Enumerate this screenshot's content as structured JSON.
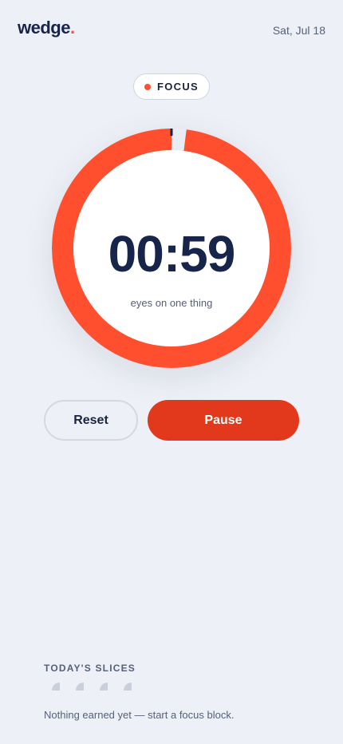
{
  "header": {
    "logo_text": "wedge",
    "logo_dot": ".",
    "date": "Sat, Jul 18"
  },
  "mode": {
    "label": "FOCUS",
    "dot_color": "#ff4f2e"
  },
  "timer": {
    "time": "00:59",
    "caption": "eyes on one thing",
    "progress_elapsed_fraction": 0.02,
    "ring_color": "#ff4f2e",
    "track_color": "#e8ecf3"
  },
  "controls": {
    "reset_label": "Reset",
    "pause_label": "Pause"
  },
  "slices": {
    "title": "TODAY'S SLICES",
    "placeholder_count": 4,
    "empty_message": "Nothing earned yet — start a focus block."
  },
  "colors": {
    "accent": "#ff4f2e",
    "pause_button": "#e2391c",
    "background": "#edf0f6",
    "text_dark": "#18254a"
  }
}
